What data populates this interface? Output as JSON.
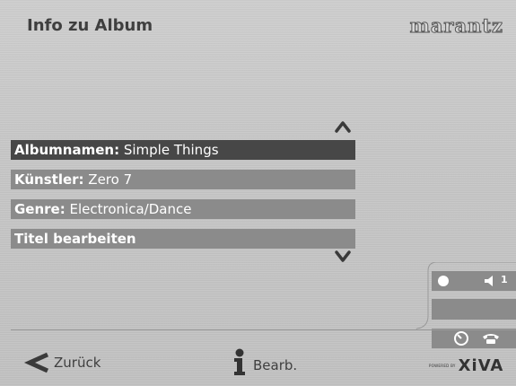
{
  "header": {
    "title": "Info zu Album",
    "brand": "marantz"
  },
  "list": {
    "items": [
      {
        "key": "Albumnamen",
        "sep": ":",
        "value": " Simple Things"
      },
      {
        "key": "Künstler",
        "sep": ":",
        "value": " Zero 7"
      },
      {
        "key": "Genre",
        "sep": ":",
        "value": " Electronica/Dance"
      },
      {
        "key": "Titel bearbeiten",
        "sep": "",
        "value": ""
      }
    ]
  },
  "status": {
    "volume": "1"
  },
  "footer": {
    "back_label": "Zurück",
    "edit_label": "Bearb.",
    "powered_by": "POWERED BY",
    "logo": "XiVA"
  }
}
